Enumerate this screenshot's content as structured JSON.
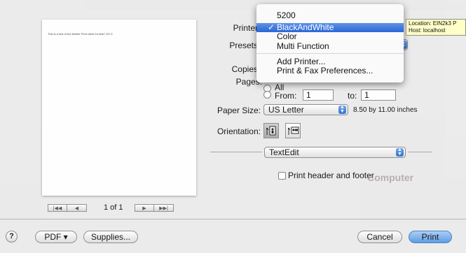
{
  "background": {
    "computer_text": "Computer"
  },
  "preview": {
    "page_text": "This is a test of the Mobile Print client for MAC OS X.",
    "page_count": "1 of 1",
    "nav_first": "|◀◀",
    "nav_prev": "◀",
    "nav_next": "▶",
    "nav_last": "▶▶|"
  },
  "form": {
    "printer_label": "Printer",
    "presets_label": "Presets",
    "copies_label": "Copies",
    "pages_label": "Pages:",
    "pages_all": "All",
    "pages_from_label": "From:",
    "pages_from_value": "1",
    "pages_to_label": "to:",
    "pages_to_value": "1",
    "paper_size_label": "Paper Size:",
    "paper_size_value": "US Letter",
    "paper_dimensions": "8.50 by 11.00 inches",
    "orientation_label": "Orientation:",
    "app_section_value": "TextEdit",
    "print_header_footer_label": "Print header and footer"
  },
  "printer_menu": {
    "items": [
      {
        "label": "5200",
        "selected": false
      },
      {
        "label": "BlackAndWhite",
        "selected": true
      },
      {
        "label": "Color",
        "selected": false
      },
      {
        "label": "Multi Function",
        "selected": false
      },
      {
        "label": "Add Printer...",
        "selected": false
      },
      {
        "label": "Print & Fax Preferences...",
        "selected": false
      }
    ],
    "check_mark": "✓"
  },
  "tooltip": {
    "line1": "Location: EIN2k3 P",
    "line2": "Host: localhost"
  },
  "bottom_bar": {
    "help_label": "?",
    "pdf_label": "PDF ▾",
    "supplies_label": "Supplies...",
    "cancel_label": "Cancel",
    "print_label": "Print"
  },
  "colors": {
    "accent": "#2a66d6",
    "tooltip_bg": "#ffffc7",
    "sheet_bg": "#ececec"
  }
}
